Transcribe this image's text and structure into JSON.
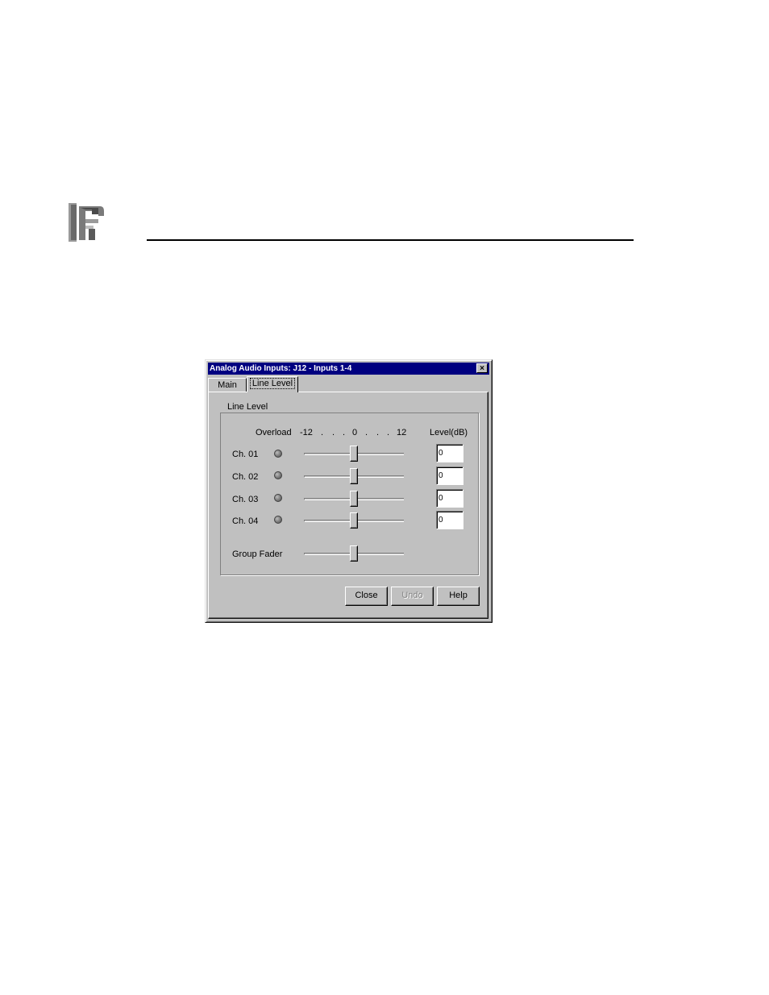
{
  "dialog": {
    "title": "Analog Audio Inputs: J12 - Inputs 1-4",
    "close_glyph": "×",
    "tabs": [
      {
        "label": "Main",
        "active": false
      },
      {
        "label": "Line Level",
        "active": true
      }
    ],
    "group_label": "Line Level",
    "headers": {
      "overload": "Overload",
      "scale": [
        "-12",
        ".",
        ".",
        ".",
        "0",
        ".",
        ".",
        ".",
        "12"
      ],
      "level": "Level(dB)"
    },
    "channels": [
      {
        "label": "Ch. 01",
        "level": "0"
      },
      {
        "label": "Ch. 02",
        "level": "0"
      },
      {
        "label": "Ch. 03",
        "level": "0"
      },
      {
        "label": "Ch. 04",
        "level": "0"
      }
    ],
    "group_fader_label": "Group Fader",
    "buttons": {
      "close": "Close",
      "undo": "Undo",
      "help": "Help"
    },
    "undo_disabled": true
  },
  "colors": {
    "titlebar": "#000080",
    "face": "#c0c0c0"
  }
}
